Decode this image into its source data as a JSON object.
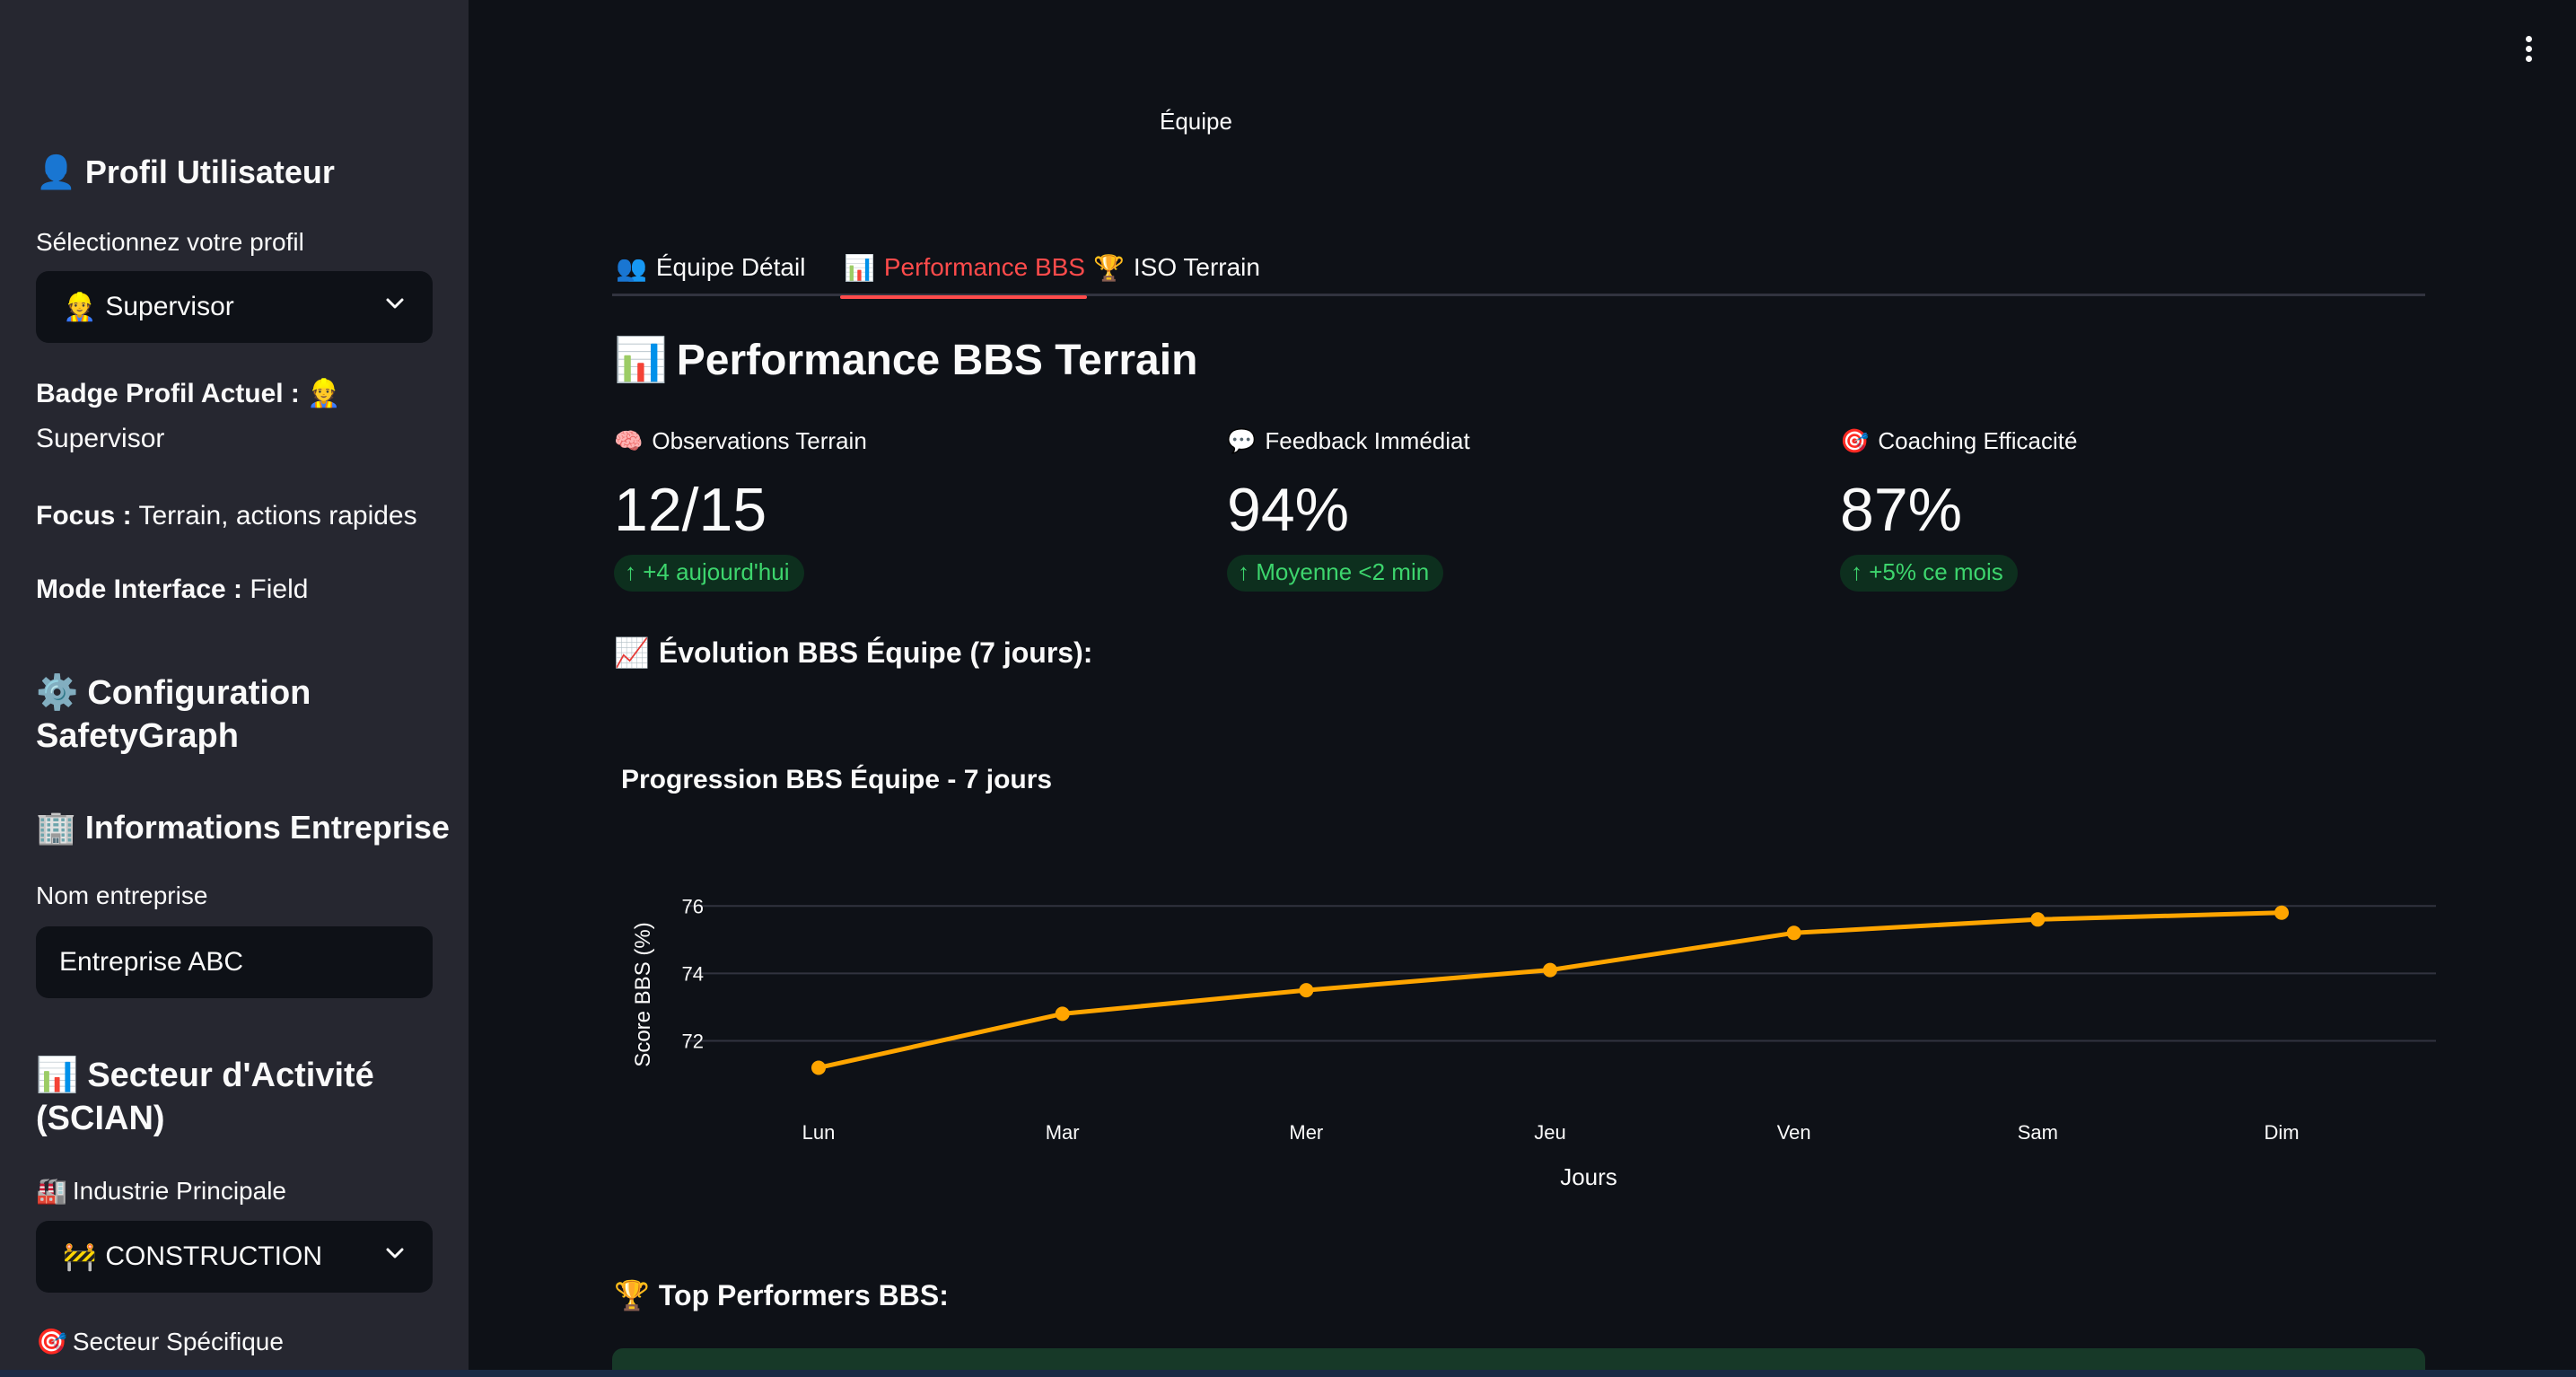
{
  "sidebar": {
    "profile_header": {
      "emoji": "👤",
      "text": "Profil Utilisateur"
    },
    "profile_select_label": "Sélectionnez votre profil",
    "profile_select": {
      "emoji": "👷",
      "value": "Supervisor"
    },
    "badge": {
      "label": "Badge Profil Actuel :",
      "emoji": "👷",
      "value": "Supervisor"
    },
    "focus": {
      "label": "Focus :",
      "value": "Terrain, actions rapides"
    },
    "mode": {
      "label": "Mode Interface :",
      "value": "Field"
    },
    "config_header": {
      "emoji": "⚙️",
      "line1": "Configuration",
      "line2": "SafetyGraph"
    },
    "company_header": {
      "emoji": "🏢",
      "text": "Informations Entreprise"
    },
    "company_name_label": "Nom entreprise",
    "company_name_value": "Entreprise ABC",
    "sector_header": {
      "emoji": "📊",
      "line1": "Secteur d'Activité",
      "line2": "(SCIAN)"
    },
    "industry_label": {
      "emoji": "🏭",
      "text": "Industrie Principale"
    },
    "industry_select": {
      "emoji": "🚧",
      "value": "CONSTRUCTION"
    },
    "specific_sector_label": {
      "emoji": "🎯",
      "text": "Secteur Spécifique"
    }
  },
  "main": {
    "equipe_label": "Équipe",
    "tabs": [
      {
        "emoji": "👥",
        "label": "Équipe Détail",
        "active": false
      },
      {
        "emoji": "📊",
        "label": "Performance BBS",
        "active": true
      },
      {
        "emoji": "🏆",
        "label": "ISO Terrain",
        "active": false
      }
    ],
    "title": {
      "emoji": "📊",
      "text": "Performance BBS Terrain"
    },
    "metrics": [
      {
        "emoji": "🧠",
        "label": "Observations Terrain",
        "value": "12/15",
        "delta": "+4 aujourd'hui"
      },
      {
        "emoji": "💬",
        "label": "Feedback Immédiat",
        "value": "94%",
        "delta": "Moyenne <2 min"
      },
      {
        "emoji": "🎯",
        "label": "Coaching Efficacité",
        "value": "87%",
        "delta": "+5% ce mois"
      }
    ],
    "evolution_header": {
      "emoji": "📈",
      "text": "Évolution BBS Équipe (7 jours):"
    },
    "top_performers_header": {
      "emoji": "🏆",
      "text": "Top Performers BBS:"
    }
  },
  "colors": {
    "accent": "#ff4b4b",
    "line": "#ffa500",
    "delta_text": "#3dd56d",
    "sidebar_bg": "#262730",
    "main_bg": "#0e1117"
  },
  "chart_data": {
    "type": "line",
    "title": "Progression BBS Équipe - 7 jours",
    "xlabel": "Jours",
    "ylabel": "Score BBS (%)",
    "categories": [
      "Lun",
      "Mar",
      "Mer",
      "Jeu",
      "Ven",
      "Sam",
      "Dim"
    ],
    "values": [
      71.2,
      72.8,
      73.5,
      74.1,
      75.2,
      75.6,
      75.8
    ],
    "yticks": [
      72,
      74,
      76
    ],
    "ylim": [
      70.6,
      76.3
    ],
    "grid": true,
    "legend": "none"
  }
}
